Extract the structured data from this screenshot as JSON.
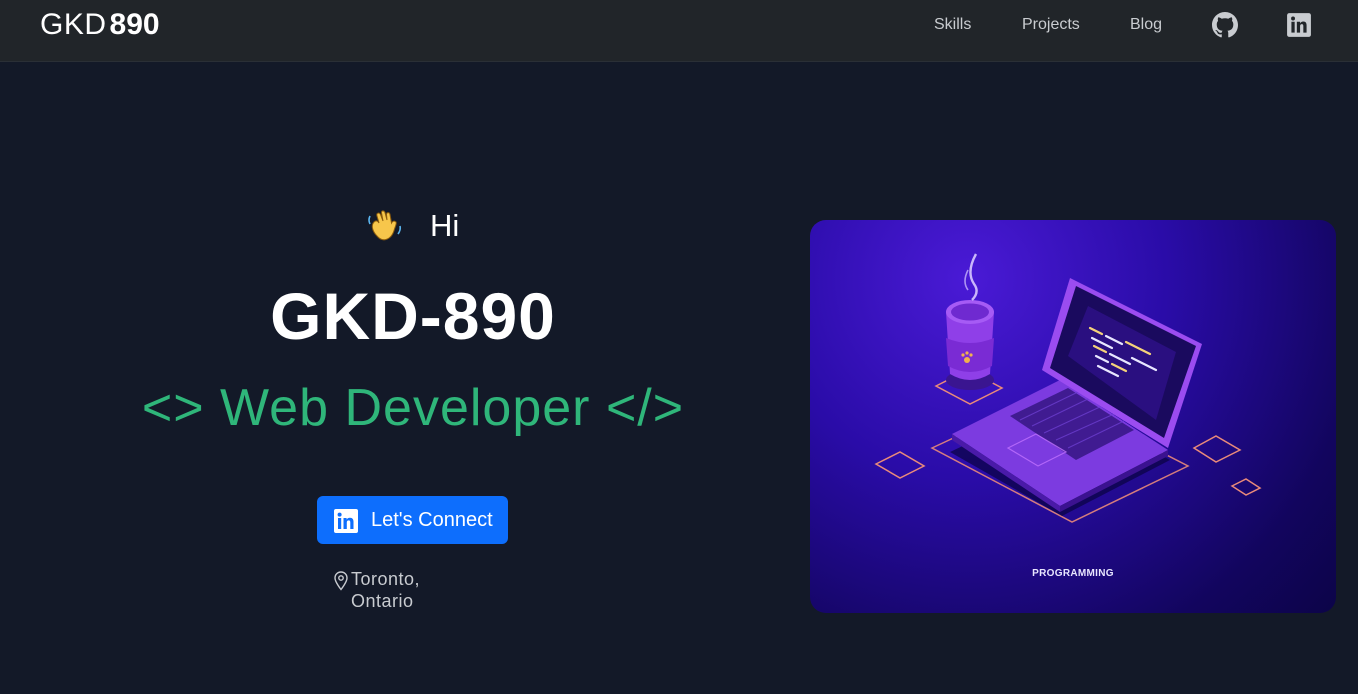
{
  "navbar": {
    "brand_light": "GKD",
    "brand_bold": "890",
    "links": [
      {
        "label": "Skills"
      },
      {
        "label": "Projects"
      },
      {
        "label": "Blog"
      }
    ],
    "icons": [
      "github-icon",
      "linkedin-icon"
    ]
  },
  "hero": {
    "greeting_icon": "waving-hand-icon",
    "greeting": "Hi",
    "name": "GKD-890",
    "role": "<> Web Developer </>",
    "cta_label": "Let's Connect",
    "cta_icon": "linkedin-icon",
    "location_icon": "map-pin-icon",
    "location": "Toronto, Ontario"
  },
  "illustration": {
    "caption": "PROGRAMMING"
  },
  "colors": {
    "navbar_bg": "#212529",
    "page_bg": "#131928",
    "accent_green": "#2fb67a",
    "button_blue": "#0d6efd"
  }
}
